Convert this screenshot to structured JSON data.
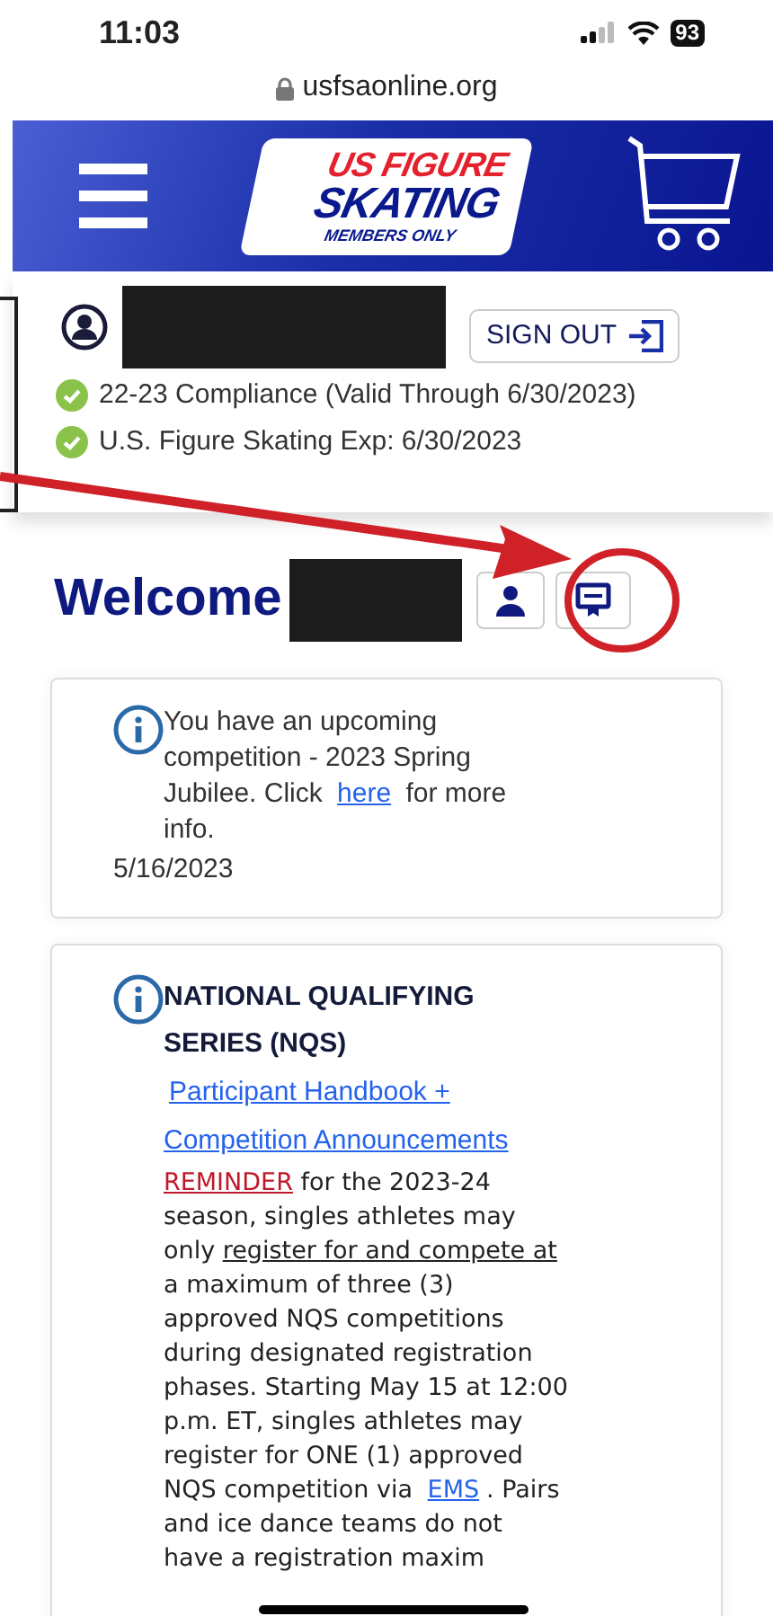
{
  "status_bar": {
    "time": "11:03",
    "battery": "93"
  },
  "url_bar": {
    "url": "usfsaonline.org"
  },
  "header": {
    "logo": {
      "line_1": "US FIGURE",
      "line_2": "SKATING",
      "line_3": "MEMBERS ONLY"
    }
  },
  "profile": {
    "sign_out": "SIGN OUT",
    "statuses": [
      {
        "text": "22-23 Compliance (Valid Through 6/30/2023)"
      },
      {
        "text": "U.S. Figure Skating Exp: 6/30/2023"
      }
    ]
  },
  "welcome": {
    "title": "Welcome"
  },
  "notices": [
    {
      "parts": [
        {
          "kind": "text",
          "text": "You have an upcoming competition - 2023 Spring Jubilee. Click "
        },
        {
          "kind": "link",
          "text": "here"
        },
        {
          "kind": "text",
          "text": " for more info."
        }
      ],
      "date": "5/16/2023"
    },
    {
      "title": "NATIONAL QUALIFYING SERIES (NQS)",
      "links": [
        "Participant Handbook +",
        "Competition Announcements"
      ],
      "parts": [
        {
          "kind": "alert",
          "text": "REMINDER"
        },
        {
          "kind": "text",
          "text": " for the 2023-24 season, singles athletes may only "
        },
        {
          "kind": "underline",
          "text": "register for and compete at"
        },
        {
          "kind": "text",
          "text": " a maximum of three (3) approved NQS competitions during designated registration phases. Starting May 15 at 12:00 p.m. ET, singles athletes may register for ONE (1) approved NQS competition via "
        },
        {
          "kind": "link",
          "text": "EMS"
        },
        {
          "kind": "text",
          "text": ". Pairs and ice dance teams do not have a registration maxim"
        }
      ]
    }
  ]
}
